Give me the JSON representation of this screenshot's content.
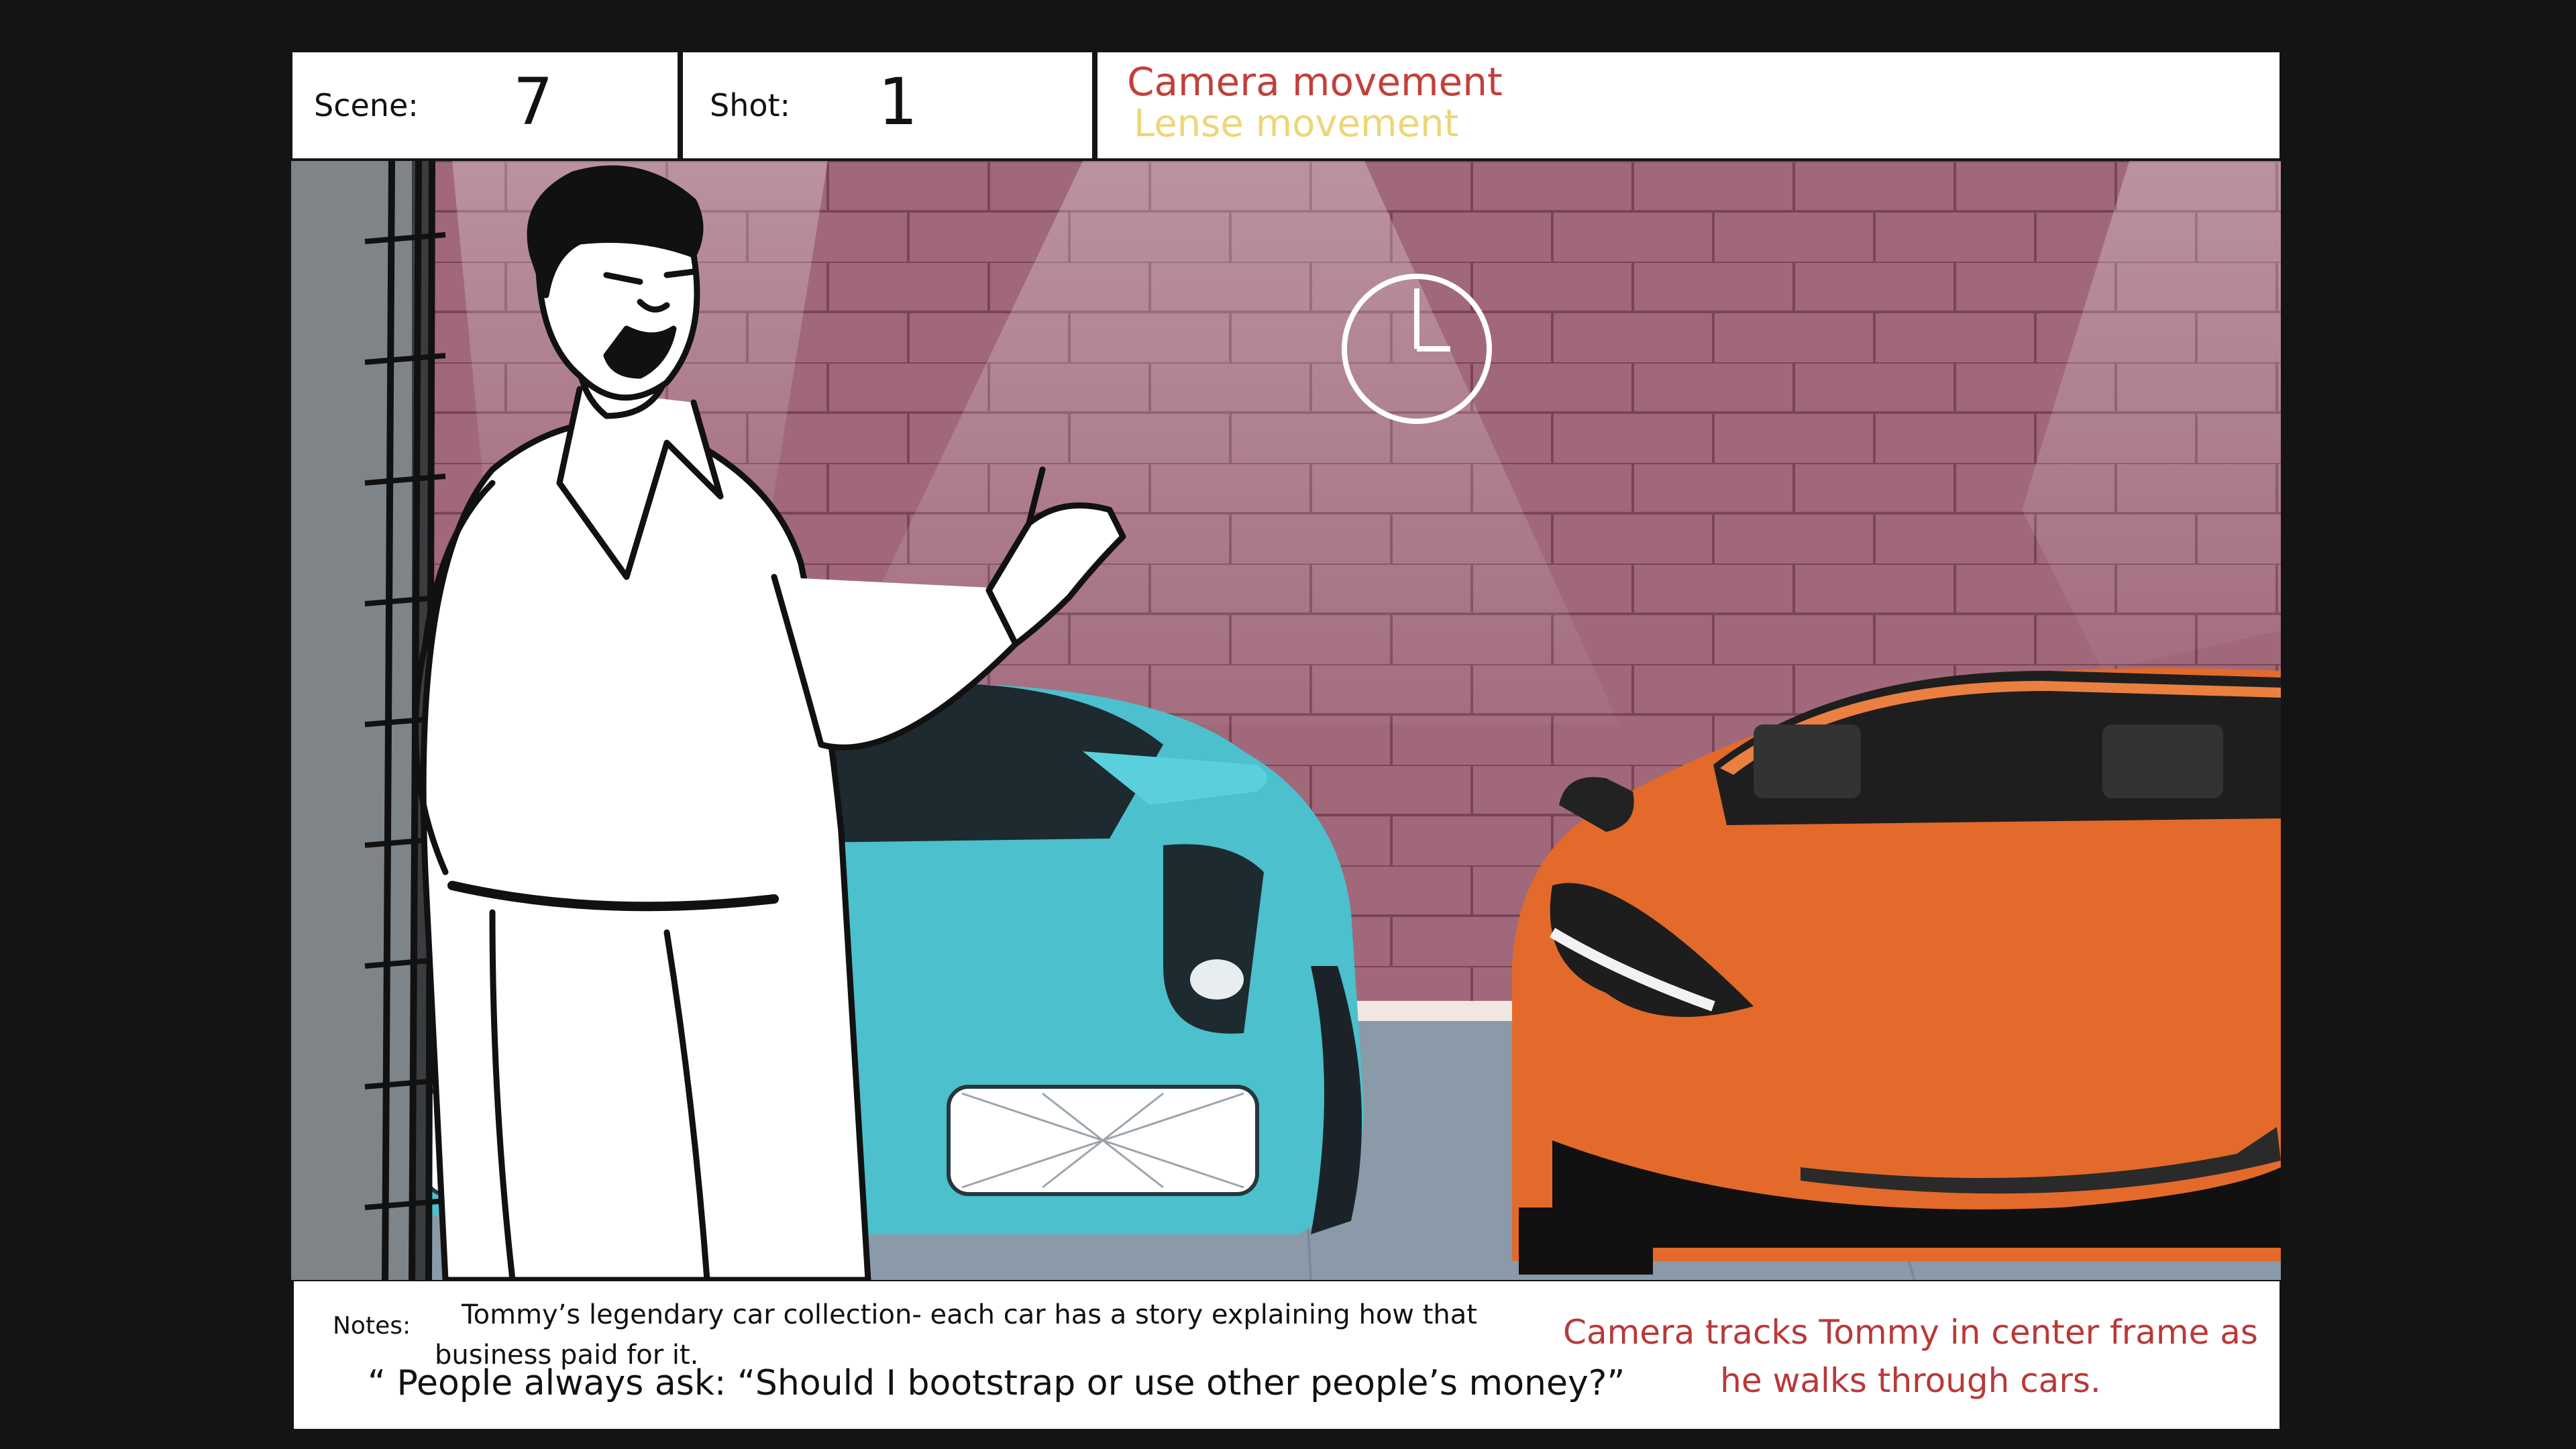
{
  "header": {
    "scene_label": "Scene:",
    "scene_value": "7",
    "shot_label": "Shot:",
    "shot_value": "1",
    "camera_movement": "Camera movement",
    "lens_movement": "Lense movement"
  },
  "colors": {
    "camera_text": "#c2403a",
    "lens_text": "#ecd678",
    "wall": "#a0687a",
    "mortar": "#7a4555",
    "floor": "#8a9aa8",
    "teal_car": "#4cc0cc",
    "orange_car": "#e36a2a"
  },
  "frame": {
    "icons": [
      "clock-icon"
    ],
    "characters": [
      "Tommy"
    ]
  },
  "notes": {
    "label": "Notes:",
    "text_line1": "Tommy’s legendary car collection- each car has a story explaining how that",
    "text_line2": "business paid for it.",
    "quote": "“ People always ask: “Should I bootstrap or use other people’s money?”",
    "camera_note": "Camera tracks Tommy in center frame as he walks through cars."
  }
}
